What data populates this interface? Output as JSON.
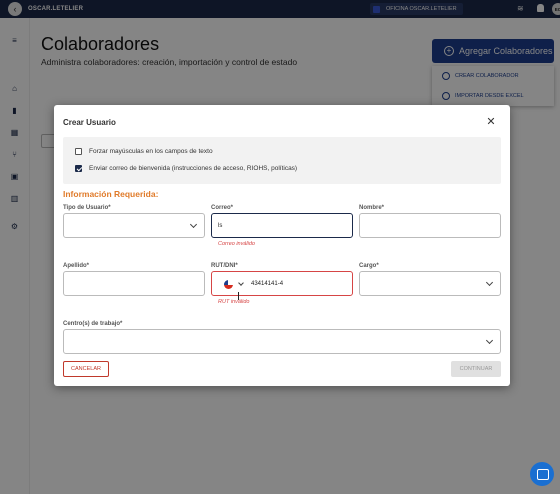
{
  "header": {
    "brand": "OSCAR.LETELIER",
    "office": "OFICINA OSCAR.LETELIER",
    "avatar_initials": "EO"
  },
  "page": {
    "title": "Colaboradores",
    "subtitle": "Administra colaboradores: creación, importación y control de estado",
    "add_button": "Agregar Colaboradores",
    "menu_items": [
      "CREAR COLABORADOR",
      "IMPORTAR DESDE EXCEL"
    ]
  },
  "modal": {
    "title": "Crear Usuario",
    "options": [
      {
        "label": "Forzar mayúsculas en los campos de texto",
        "checked": false
      },
      {
        "label": "Enviar correo de bienvenida (instrucciones de acceso, RIOHS, políticas)",
        "checked": true
      }
    ],
    "section_title": "Información Requerida:",
    "fields": {
      "tipo_usuario": {
        "label": "Tipo de Usuario*",
        "value": ""
      },
      "correo": {
        "label": "Correo*",
        "value": "ls",
        "error": "Correo inválido"
      },
      "nombre": {
        "label": "Nombre*",
        "value": ""
      },
      "apellido": {
        "label": "Apellido*",
        "value": ""
      },
      "rut": {
        "label": "RUT/DNI*",
        "value": "43414141-4",
        "error": "RUT inválido"
      },
      "cargo": {
        "label": "Cargo*",
        "value": ""
      },
      "centros": {
        "label": "Centro(s) de trabajo*",
        "value": ""
      }
    },
    "cancel_label": "CANCELAR",
    "continue_label": "CONTINUAR"
  }
}
